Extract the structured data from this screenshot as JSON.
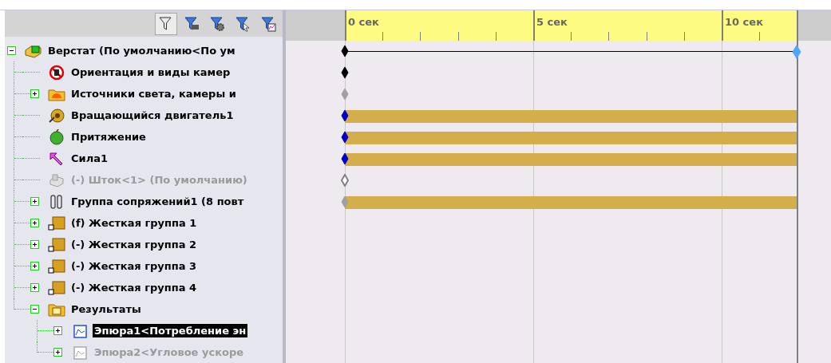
{
  "toolbar": {
    "buttons": [
      {
        "kind": "filter",
        "selected": true
      },
      {
        "kind": "filter-camera",
        "selected": false
      },
      {
        "kind": "filter-gear",
        "selected": false
      },
      {
        "kind": "filter-pointer",
        "selected": false
      },
      {
        "kind": "filter-chart",
        "selected": false
      }
    ]
  },
  "tree": {
    "items": [
      {
        "label": "Верстат  (По умолчанию<По ум",
        "kind": "assembly",
        "expanded": true,
        "dimmed": false,
        "selected": false,
        "children": [
          {
            "label": "Ориентация и виды камер",
            "kind": "camera-views",
            "dimmed": false,
            "selected": false
          },
          {
            "label": "Источники света, камеры и",
            "kind": "lights",
            "expanded": false,
            "dimmed": false,
            "selected": false
          },
          {
            "label": "Вращающийся двигатель1",
            "kind": "motor",
            "dimmed": false,
            "selected": false
          },
          {
            "label": "Притяжение",
            "kind": "gravity",
            "dimmed": false,
            "selected": false
          },
          {
            "label": "Сила1",
            "kind": "force",
            "dimmed": false,
            "selected": false
          },
          {
            "label": "(-) Шток<1> (По умолчанию)",
            "kind": "part",
            "dimmed": true,
            "selected": false
          },
          {
            "label": "Группа сопряжений1 (8 повт",
            "kind": "mates",
            "expanded": false,
            "dimmed": false,
            "selected": false
          },
          {
            "label": "(f) Жесткая группа 1",
            "kind": "rigid-group",
            "expanded": false,
            "dimmed": false,
            "selected": false
          },
          {
            "label": "(-) Жесткая группа 2",
            "kind": "rigid-group",
            "expanded": false,
            "dimmed": false,
            "selected": false
          },
          {
            "label": "(-) Жесткая группа 3",
            "kind": "rigid-group",
            "expanded": false,
            "dimmed": false,
            "selected": false
          },
          {
            "label": "(-) Жесткая группа 4",
            "kind": "rigid-group",
            "expanded": false,
            "dimmed": false,
            "selected": false
          },
          {
            "label": "Результаты",
            "kind": "results",
            "expanded": true,
            "dimmed": false,
            "selected": false,
            "children": [
              {
                "label": "Эпюра1<Потребление эн",
                "kind": "plot",
                "expanded": false,
                "dimmed": false,
                "selected": true
              },
              {
                "label": "Эпюра2<Угловое ускоре",
                "kind": "plot",
                "expanded": false,
                "dimmed": true,
                "selected": false
              }
            ]
          }
        ]
      }
    ]
  },
  "timeline": {
    "ticks": [
      "0 сек",
      "5 сек",
      "10 сек"
    ],
    "rows": [
      {
        "start_key": {
          "color": "#000000",
          "hollow": false
        },
        "end_key": {
          "color": "#4da6ff",
          "hollow": false
        },
        "line": true,
        "bar": false
      },
      {
        "start_key": {
          "color": "#000000",
          "hollow": false
        },
        "line": false,
        "bar": false
      },
      {
        "start_key": {
          "color": "#a0a0a0",
          "hollow": false
        },
        "line": false,
        "bar": false
      },
      {
        "start_key": {
          "color": "#0000cc",
          "hollow": false
        },
        "line": false,
        "bar": true
      },
      {
        "start_key": {
          "color": "#0000cc",
          "hollow": false
        },
        "line": false,
        "bar": true
      },
      {
        "start_key": {
          "color": "#0000cc",
          "hollow": false
        },
        "line": false,
        "bar": true
      },
      {
        "start_key": {
          "color": "#808080",
          "hollow": true
        },
        "line": false,
        "bar": false
      },
      {
        "start_key": {
          "color": "#a0a0a0",
          "hollow": false
        },
        "line": false,
        "bar": true
      }
    ]
  }
}
